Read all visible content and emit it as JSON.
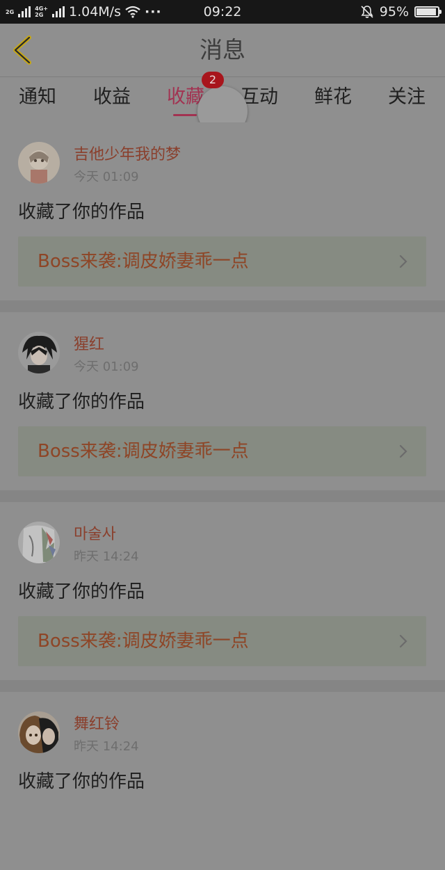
{
  "status_bar": {
    "network_tags": [
      "2G",
      "4G+",
      "2G"
    ],
    "speed": "1.04M/s",
    "more": "···",
    "time": "09:22",
    "battery": "95%",
    "battery_level": 0.95
  },
  "header": {
    "title": "消息",
    "back_icon": "chevron-left-icon"
  },
  "tabs": [
    {
      "label": "通知"
    },
    {
      "label": "收益"
    },
    {
      "label": "收藏",
      "active": true,
      "badge": "2"
    },
    {
      "label": "互动"
    },
    {
      "label": "鲜花"
    },
    {
      "label": "关注"
    }
  ],
  "colors": {
    "active_tab": "#a23251",
    "badge": "#a8151c",
    "username": "#8a3f2c",
    "work_title": "#8e4526"
  },
  "messages": [
    {
      "user": "吉他少年我的梦",
      "time": "今天 01:09",
      "action": "收藏了你的作品",
      "work": "Boss来袭:调皮娇妻乖一点"
    },
    {
      "user": "猩红",
      "time": "今天 01:09",
      "action": "收藏了你的作品",
      "work": "Boss来袭:调皮娇妻乖一点"
    },
    {
      "user": "마술사",
      "time": "昨天 14:24",
      "action": "收藏了你的作品",
      "work": "Boss来袭:调皮娇妻乖一点"
    },
    {
      "user": "舞红铃",
      "time": "昨天 14:24",
      "action": "收藏了你的作品",
      "work": ""
    }
  ]
}
